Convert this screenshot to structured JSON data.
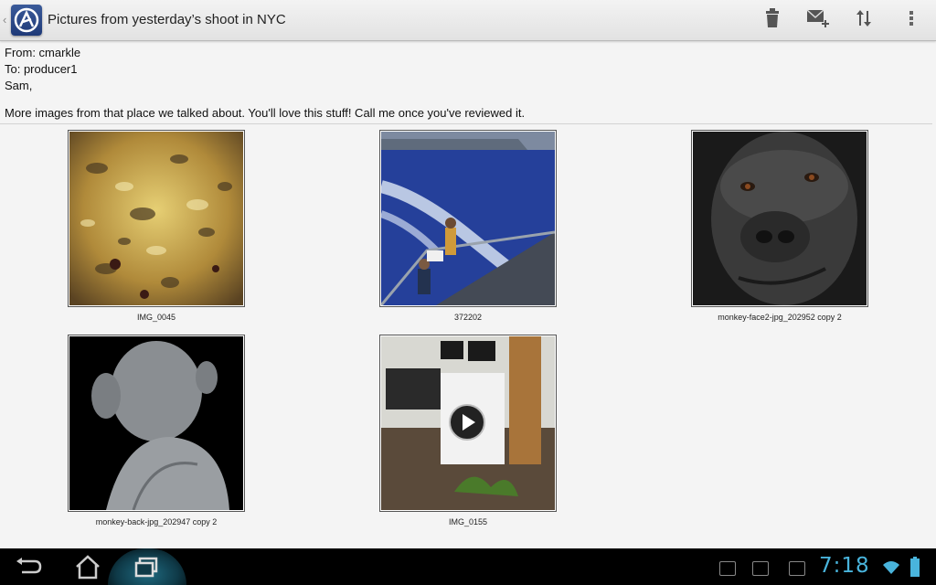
{
  "actionbar": {
    "title": "Pictures from yesterday’s shoot in NYC",
    "up_caret": "‹",
    "actions": [
      "delete-icon",
      "compose-icon",
      "sort-icon",
      "overflow-menu-icon"
    ]
  },
  "message": {
    "from": "From: cmarkle",
    "to": "To: producer1",
    "greeting": "Sam,",
    "body": "More images from that place we talked about. You'll love this stuff! Call me once you've reviewed it."
  },
  "attachments": [
    {
      "caption": "IMG_0045",
      "kind": "image"
    },
    {
      "caption": "372202",
      "kind": "image"
    },
    {
      "caption": "monkey-face2-jpg_202952 copy 2",
      "kind": "image"
    },
    {
      "caption": "monkey-back-jpg_202947 copy 2",
      "kind": "image"
    },
    {
      "caption": "IMG_0155",
      "kind": "video"
    }
  ],
  "systembar": {
    "time": "7:18",
    "accent": "#49b4dc",
    "buttons": [
      "back-icon",
      "home-icon",
      "recent-apps-icon"
    ]
  }
}
